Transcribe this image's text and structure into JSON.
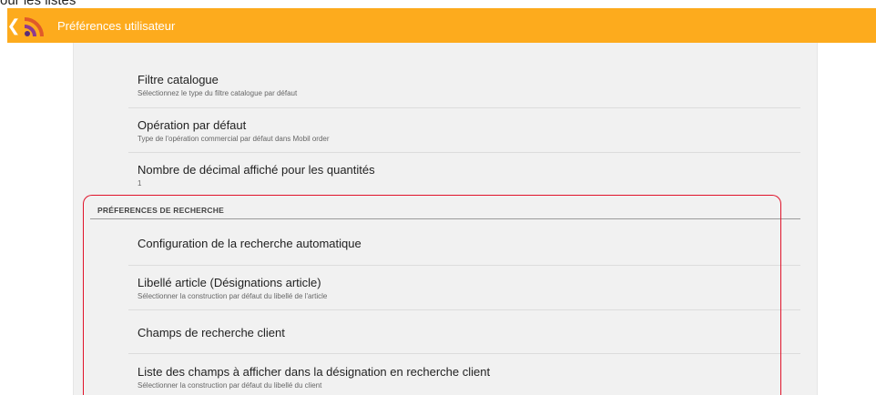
{
  "top_fragment": "our les listes",
  "appbar": {
    "title": "Préférences utilisateur",
    "background": "#fdab1d",
    "logo_colors": [
      "#5a2d78",
      "#8e3a8f",
      "#e05a2a"
    ]
  },
  "general_items": [
    {
      "title": "Filtre catalogue",
      "summary": "Sélectionnez le type du filtre catalogue par défaut"
    },
    {
      "title": "Opération par défaut",
      "summary": "Type de l'opération commercial par défaut dans Mobil order"
    },
    {
      "title": "Nombre de décimal affiché pour les quantités",
      "summary": "1"
    }
  ],
  "search_section": {
    "header": "PRÉFERENCES DE RECHERCHE",
    "highlight_color": "#e0132a",
    "items": [
      {
        "title": "Configuration de la recherche automatique",
        "summary": ""
      },
      {
        "title": "Libellé article (Désignations article)",
        "summary": "Sélectionner la construction par défaut du libellé de l'article"
      },
      {
        "title": "Champs de recherche client",
        "summary": ""
      },
      {
        "title": "Liste des champs à afficher dans la désignation en recherche client",
        "summary": "Sélectionner la construction par défaut du libellé du client"
      }
    ]
  }
}
